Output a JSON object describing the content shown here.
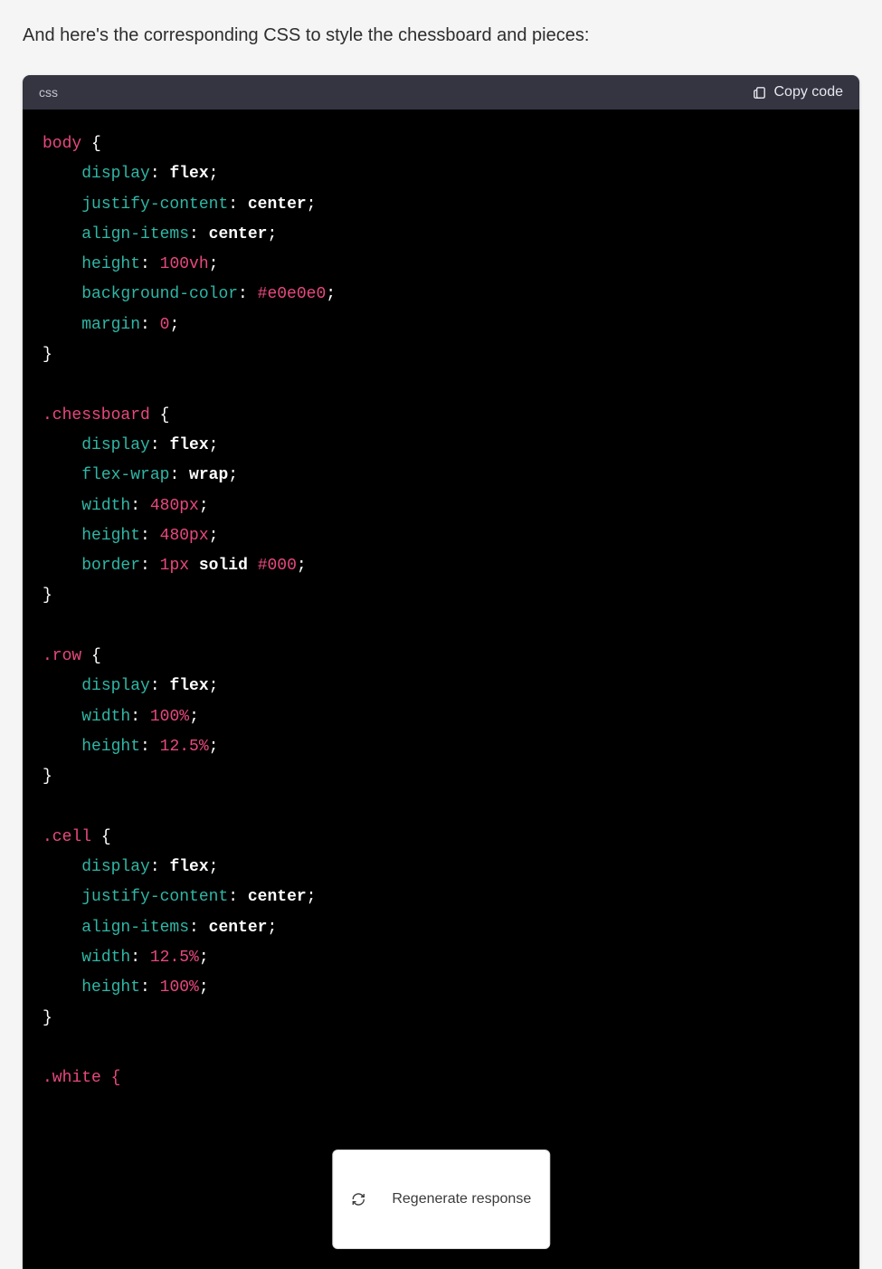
{
  "intro_text": "And here's the corresponding CSS to style the chessboard and pieces:",
  "code_header": {
    "language_label": "css",
    "copy_label": "Copy code"
  },
  "regenerate_label": "Regenerate response",
  "code": {
    "rules": [
      {
        "selector": "body",
        "declarations": [
          {
            "property": "display",
            "value": "flex",
            "value_kind": "kw"
          },
          {
            "property": "justify-content",
            "value": "center",
            "value_kind": "kw"
          },
          {
            "property": "align-items",
            "value": "center",
            "value_kind": "kw"
          },
          {
            "property": "height",
            "value": "100vh",
            "value_kind": "num"
          },
          {
            "property": "background-color",
            "value": "#e0e0e0",
            "value_kind": "num"
          },
          {
            "property": "margin",
            "value": "0",
            "value_kind": "num"
          }
        ]
      },
      {
        "selector": ".chessboard",
        "declarations": [
          {
            "property": "display",
            "value": "flex",
            "value_kind": "kw"
          },
          {
            "property": "flex-wrap",
            "value": "wrap",
            "value_kind": "kw"
          },
          {
            "property": "width",
            "value": "480px",
            "value_kind": "num"
          },
          {
            "property": "height",
            "value": "480px",
            "value_kind": "num"
          },
          {
            "property": "border",
            "value_segments": [
              {
                "text": "1px",
                "kind": "num"
              },
              {
                "text": " ",
                "kind": "space"
              },
              {
                "text": "solid",
                "kind": "kw"
              },
              {
                "text": " ",
                "kind": "space"
              },
              {
                "text": "#000",
                "kind": "num"
              }
            ]
          }
        ]
      },
      {
        "selector": ".row",
        "declarations": [
          {
            "property": "display",
            "value": "flex",
            "value_kind": "kw"
          },
          {
            "property": "width",
            "value": "100%",
            "value_kind": "num"
          },
          {
            "property": "height",
            "value": "12.5%",
            "value_kind": "num"
          }
        ]
      },
      {
        "selector": ".cell",
        "declarations": [
          {
            "property": "display",
            "value": "flex",
            "value_kind": "kw"
          },
          {
            "property": "justify-content",
            "value": "center",
            "value_kind": "kw"
          },
          {
            "property": "align-items",
            "value": "center",
            "value_kind": "kw"
          },
          {
            "property": "width",
            "value": "12.5%",
            "value_kind": "num"
          },
          {
            "property": "height",
            "value": "100%",
            "value_kind": "num"
          }
        ]
      }
    ],
    "trailing_selector": ".white {"
  }
}
